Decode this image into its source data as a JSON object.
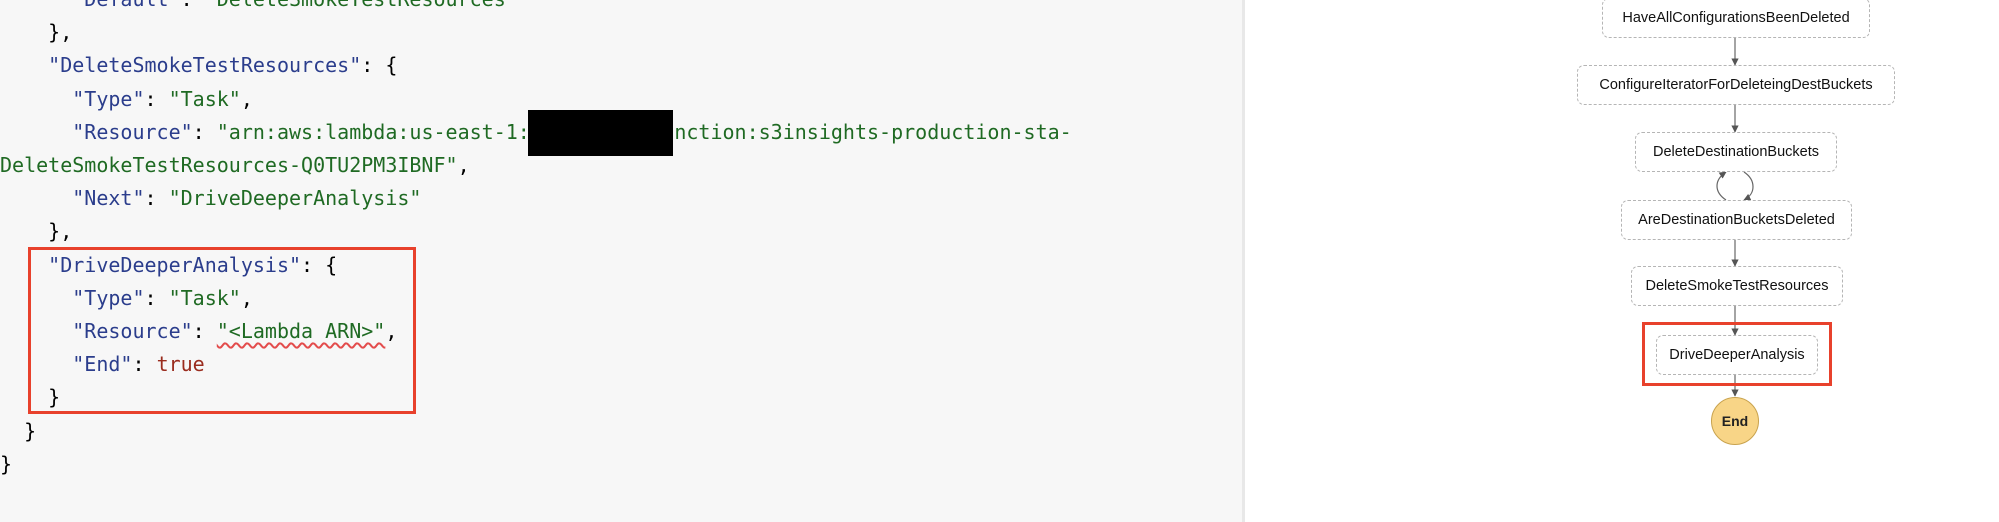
{
  "editor": {
    "lines": [
      [
        {
          "t": "      ",
          "c": "p"
        },
        {
          "t": "\"Default\"",
          "c": "k"
        },
        {
          "t": ": ",
          "c": "p"
        },
        {
          "t": "\"DeleteSmokeTestResources\"",
          "c": "s"
        }
      ],
      [
        {
          "t": "    },",
          "c": "p"
        }
      ],
      [
        {
          "t": "    ",
          "c": "p"
        },
        {
          "t": "\"DeleteSmokeTestResources\"",
          "c": "k"
        },
        {
          "t": ": {",
          "c": "p"
        }
      ],
      [
        {
          "t": "      ",
          "c": "p"
        },
        {
          "t": "\"Type\"",
          "c": "k"
        },
        {
          "t": ": ",
          "c": "p"
        },
        {
          "t": "\"Task\"",
          "c": "s"
        },
        {
          "t": ",",
          "c": "p"
        }
      ],
      [
        {
          "t": "      ",
          "c": "p"
        },
        {
          "t": "\"Resource\"",
          "c": "k"
        },
        {
          "t": ": ",
          "c": "p"
        },
        {
          "t": "\"arn:aws:lambda:us-east-1:",
          "c": "s"
        },
        {
          "t": "         ",
          "c": "p"
        },
        {
          "t": ":function:s3insights-production-sta-",
          "c": "s"
        }
      ],
      [
        {
          "t": "DeleteSmokeTestResources-Q0TU2PM3IBNF\"",
          "c": "s"
        },
        {
          "t": ",",
          "c": "p"
        }
      ],
      [
        {
          "t": "      ",
          "c": "p"
        },
        {
          "t": "\"Next\"",
          "c": "k"
        },
        {
          "t": ": ",
          "c": "p"
        },
        {
          "t": "\"DriveDeeperAnalysis\"",
          "c": "s"
        }
      ],
      [
        {
          "t": "    },",
          "c": "p"
        }
      ],
      [
        {
          "t": "    ",
          "c": "p"
        },
        {
          "t": "\"DriveDeeperAnalysis\"",
          "c": "k"
        },
        {
          "t": ": {",
          "c": "p"
        }
      ],
      [
        {
          "t": "      ",
          "c": "p"
        },
        {
          "t": "\"Type\"",
          "c": "k"
        },
        {
          "t": ": ",
          "c": "p"
        },
        {
          "t": "\"Task\"",
          "c": "s"
        },
        {
          "t": ",",
          "c": "p"
        }
      ],
      [
        {
          "t": "      ",
          "c": "p"
        },
        {
          "t": "\"Resource\"",
          "c": "k"
        },
        {
          "t": ": ",
          "c": "p"
        },
        {
          "t": "\"<Lambda ARN>\"",
          "c": "s",
          "sq": true
        },
        {
          "t": ",",
          "c": "p"
        }
      ],
      [
        {
          "t": "      ",
          "c": "p"
        },
        {
          "t": "\"End\"",
          "c": "k"
        },
        {
          "t": ": ",
          "c": "p"
        },
        {
          "t": "true",
          "c": "b"
        }
      ],
      [
        {
          "t": "    }",
          "c": "p"
        }
      ],
      [
        {
          "t": "  }",
          "c": "p"
        }
      ],
      [
        {
          "t": "}",
          "c": "p"
        }
      ]
    ]
  },
  "graph": {
    "nodes": {
      "have_all_configs_deleted": "HaveAllConfigurationsBeenDeleted",
      "configure_iterator": "ConfigureIteratorForDeleteingDestBuckets",
      "delete_dest_buckets": "DeleteDestinationBuckets",
      "are_dest_buckets_deleted": "AreDestinationBucketsDeleted",
      "delete_smoke_test_resources": "DeleteSmokeTestResources",
      "drive_deeper_analysis": "DriveDeeperAnalysis",
      "end": "End"
    }
  },
  "colors": {
    "highlight": "#e8412c",
    "json_key": "#2b3d8c",
    "json_string": "#1f6a23",
    "json_boolean": "#9a2c1e",
    "end_node_fill": "#f8d587"
  }
}
